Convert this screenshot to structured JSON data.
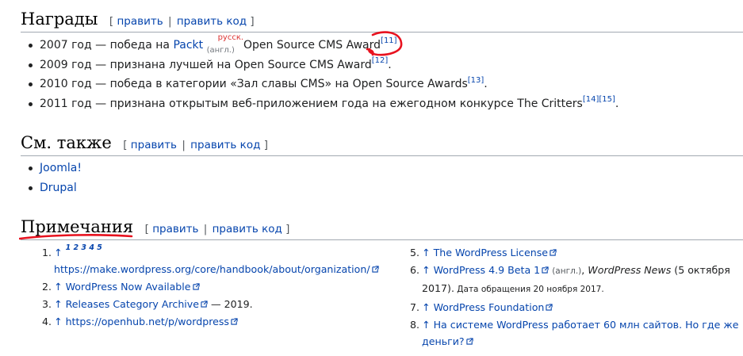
{
  "sections": {
    "awards": {
      "title": "Награды",
      "edit": {
        "open": "[",
        "edit_label": "править",
        "sep": "|",
        "edit_code_label": "править код",
        "close": "]"
      },
      "items": [
        {
          "before": "2007 год — победа на ",
          "link": "Packt",
          "lang_sup": "русск.",
          "lang_sub": "(англ.)",
          "after": " Open Source CMS Award",
          "refs": [
            "[11]"
          ],
          "end": ""
        },
        {
          "before": "2009 год — признана лучшей на Open Source CMS Award",
          "refs": [
            "[12]"
          ],
          "end": "."
        },
        {
          "before": "2010 год — победа в категории «Зал славы CMS» на Open Source Awards",
          "refs": [
            "[13]"
          ],
          "end": "."
        },
        {
          "before": "2011 год — признана открытым веб-приложением года на ежегодном конкурсе The Critters",
          "refs": [
            "[14]",
            "[15]"
          ],
          "end": "."
        }
      ]
    },
    "see_also": {
      "title": "См. также",
      "edit": {
        "open": "[",
        "edit_label": "править",
        "sep": "|",
        "edit_code_label": "править код",
        "close": "]"
      },
      "items": [
        "Joomla!",
        "Drupal"
      ]
    },
    "notes": {
      "title": "Примечания",
      "edit": {
        "open": "[",
        "edit_label": "править",
        "sep": "|",
        "edit_code_label": "править код",
        "close": "]"
      },
      "left": [
        {
          "num": "1.",
          "arrow": "↑",
          "backrefs": "1 2 3 4 5",
          "url": "https://make.wordpress.org/core/handbook/about/organization/"
        },
        {
          "num": "2.",
          "arrow": "↑",
          "text": "WordPress Now Available"
        },
        {
          "num": "3.",
          "arrow": "↑",
          "text": "Releases Category Archive",
          "suffix": " — 2019."
        },
        {
          "num": "4.",
          "arrow": "↑",
          "text": "https://openhub.net/p/wordpress"
        }
      ],
      "right": [
        {
          "num": "5.",
          "arrow": "↑",
          "text": "The WordPress License"
        },
        {
          "num": "6.",
          "arrow": "↑",
          "text": "WordPress 4.9 Beta 1",
          "lang": "(англ.)",
          "sep": ", ",
          "source": "WordPress News",
          "date": " (5 октября",
          "date2": "2017).",
          "accessed": " Дата обращения 20 ноября 2017."
        },
        {
          "num": "7.",
          "arrow": "↑",
          "text": "WordPress Foundation"
        },
        {
          "num": "8.",
          "arrow": "↑",
          "text": "На системе WordPress работает 60 млн сайтов. Но где же",
          "text2": "деньги?"
        }
      ]
    }
  },
  "colors": {
    "link": "#0645ad",
    "annotation": "#e8121f",
    "text": "#202122"
  }
}
